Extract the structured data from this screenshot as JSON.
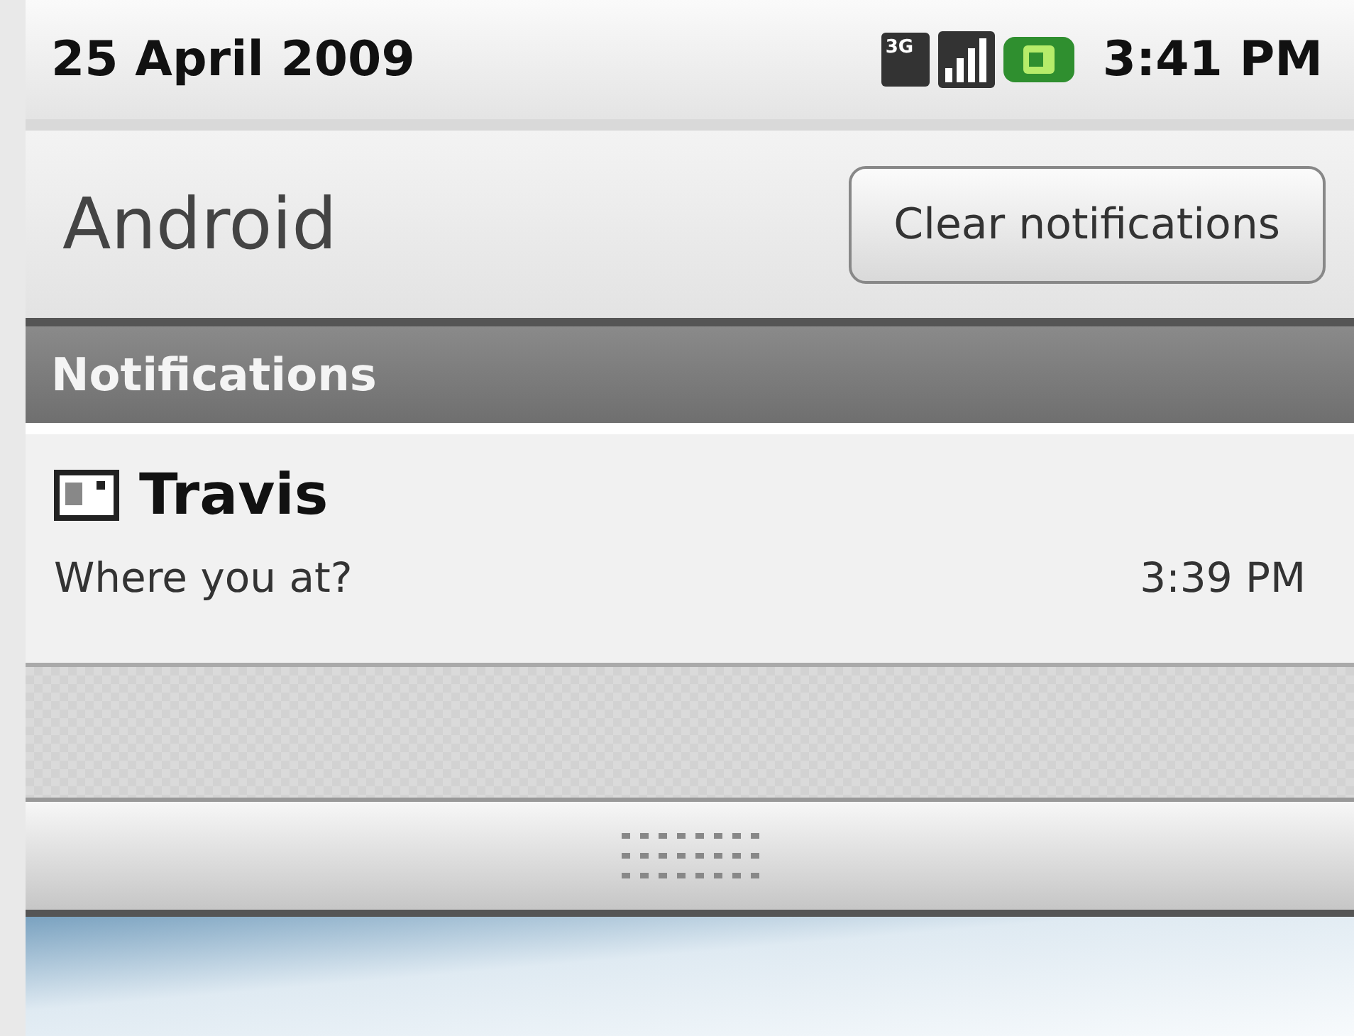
{
  "status_bar": {
    "date": "25 April 2009",
    "network_label": "3G",
    "time": "3:41 PM"
  },
  "header": {
    "title": "Android",
    "clear_button": "Clear notifications"
  },
  "section": {
    "title": "Notifications"
  },
  "notifications": [
    {
      "title": "Travis",
      "message": "Where you at?",
      "time": "3:39 PM"
    }
  ]
}
